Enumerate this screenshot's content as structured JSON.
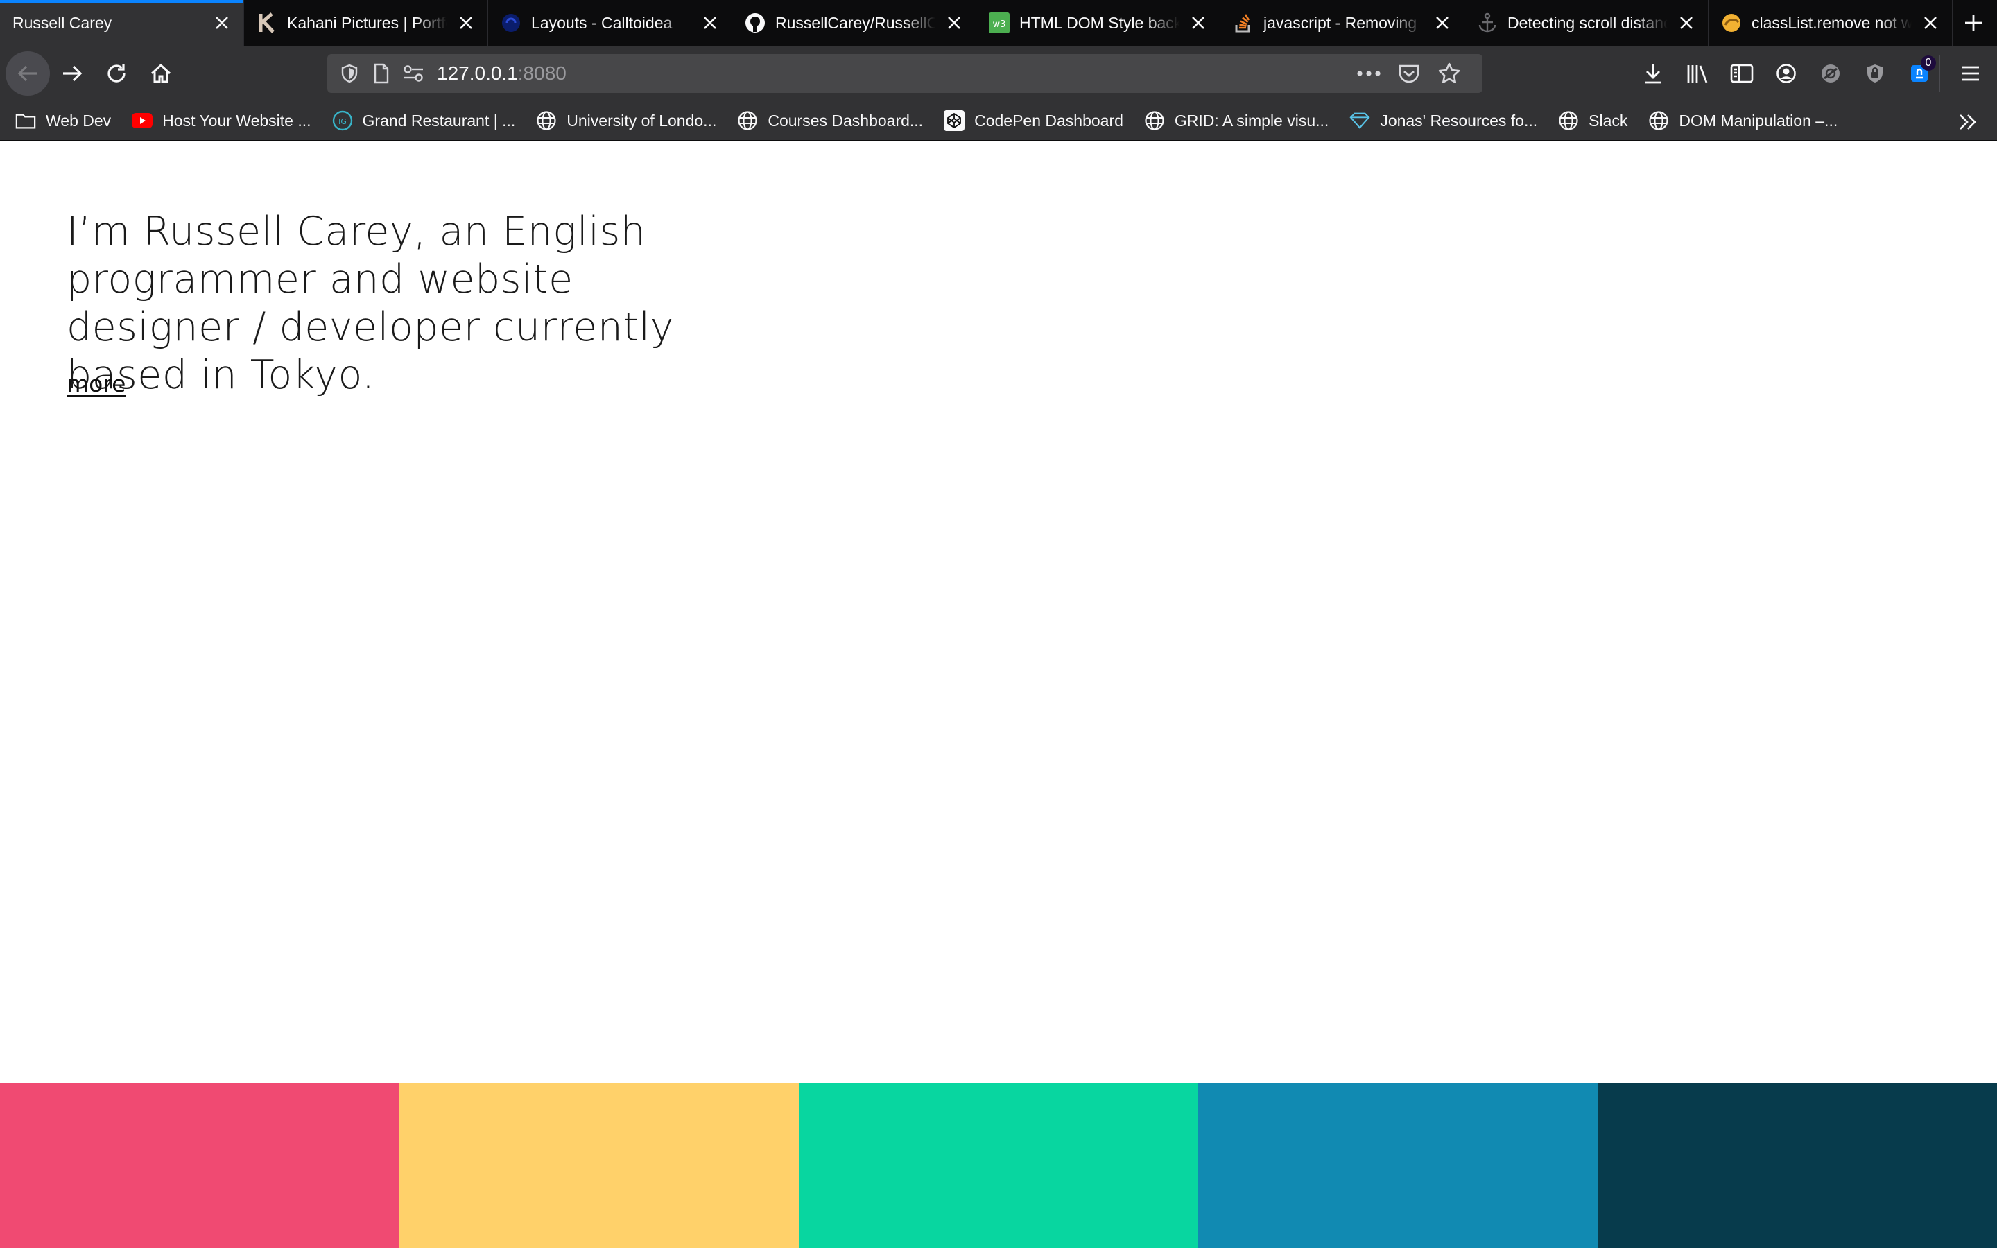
{
  "tabs": [
    {
      "title": "Russell Carey",
      "favicon": "none",
      "active": true
    },
    {
      "title": "Kahani Pictures | Portfolio",
      "favicon": "kahani-k-icon"
    },
    {
      "title": "Layouts - Calltoidea",
      "favicon": "calltoidea-icon"
    },
    {
      "title": "RussellCarey/RussellCarey",
      "favicon": "github-icon"
    },
    {
      "title": "HTML DOM Style background",
      "favicon": "w3schools-icon"
    },
    {
      "title": "javascript - Removing",
      "favicon": "stackoverflow-icon"
    },
    {
      "title": "Detecting scroll distance",
      "favicon": "anchor-icon"
    },
    {
      "title": "classList.remove not working",
      "favicon": "yellow-site-icon"
    }
  ],
  "url": {
    "host": "127.0.0.1",
    "port": ":8080"
  },
  "toolbar": {
    "notification_count": "0"
  },
  "bookmarks": [
    {
      "label": "Web Dev",
      "icon": "folder-icon"
    },
    {
      "label": "Host Your Website ...",
      "icon": "youtube-icon"
    },
    {
      "label": "Grand Restaurant | ...",
      "icon": "grand-restaurant-icon"
    },
    {
      "label": "University of Londo...",
      "icon": "globe-icon"
    },
    {
      "label": "Courses Dashboard...",
      "icon": "globe-icon"
    },
    {
      "label": "CodePen Dashboard",
      "icon": "codepen-icon"
    },
    {
      "label": "GRID: A simple visu...",
      "icon": "globe-icon"
    },
    {
      "label": "Jonas' Resources fo...",
      "icon": "diamond-icon"
    },
    {
      "label": "Slack",
      "icon": "globe-icon"
    },
    {
      "label": "DOM Manipulation –...",
      "icon": "globe-icon"
    }
  ],
  "page": {
    "intro": "I’m Russell Carey, an English programmer and website designer / developer currently based in Tokyo.",
    "more_link": "more"
  },
  "palette": [
    "#f04a72",
    "#ffd16a",
    "#08d6a0",
    "#118ab2",
    "#073b4c"
  ],
  "colors": {
    "accent": "#0a84ff",
    "tabstrip": "#0c0c0d",
    "toolbar": "#323234"
  }
}
